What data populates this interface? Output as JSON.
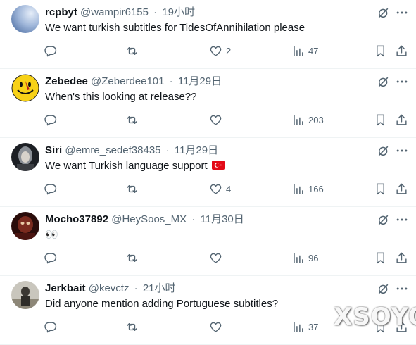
{
  "replies": [
    {
      "name": "rcpbyt",
      "handle": "@wampir6155",
      "separator": "·",
      "time": "19小时",
      "text": "We want turkish subtitles for TidesOfAnnihilation please",
      "has_flag": false,
      "replies_count": "",
      "retweets_count": "",
      "likes_count": "2",
      "views_count": "47",
      "avatar": "blue-gradient"
    },
    {
      "name": "Zebedee",
      "handle": "@Zeberdee101",
      "separator": "·",
      "time": "11月29日",
      "text": "When's this looking at release??",
      "has_flag": false,
      "replies_count": "",
      "retweets_count": "",
      "likes_count": "",
      "views_count": "203",
      "avatar": "yellow-smiley"
    },
    {
      "name": "Siri",
      "handle": "@emre_sedef38435",
      "separator": "·",
      "time": "11月29日",
      "text": "We want Turkish language support",
      "has_flag": true,
      "replies_count": "",
      "retweets_count": "",
      "likes_count": "4",
      "views_count": "166",
      "avatar": "dark-portrait"
    },
    {
      "name": "Mocho37892",
      "handle": "@HeySoos_MX",
      "separator": "·",
      "time": "11月30日",
      "text": "👀",
      "has_flag": false,
      "replies_count": "",
      "retweets_count": "",
      "likes_count": "",
      "views_count": "96",
      "avatar": "red-portrait"
    },
    {
      "name": "Jerkbait",
      "handle": "@kevctz",
      "separator": "·",
      "time": "21小时",
      "text": "Did anyone mention adding Portuguese subtitles?",
      "has_flag": false,
      "replies_count": "",
      "retweets_count": "",
      "likes_count": "",
      "views_count": "37",
      "avatar": "gray-figure"
    }
  ],
  "icons": {
    "grok": "grok-icon",
    "more": "more-icon",
    "reply": "reply-icon",
    "retweet": "retweet-icon",
    "like": "like-icon",
    "views": "views-icon",
    "bookmark": "bookmark-icon",
    "share": "share-icon"
  },
  "colors": {
    "text": "#0f1419",
    "muted": "#536471",
    "divider": "#eff3f4"
  },
  "watermark": "XSOYO"
}
